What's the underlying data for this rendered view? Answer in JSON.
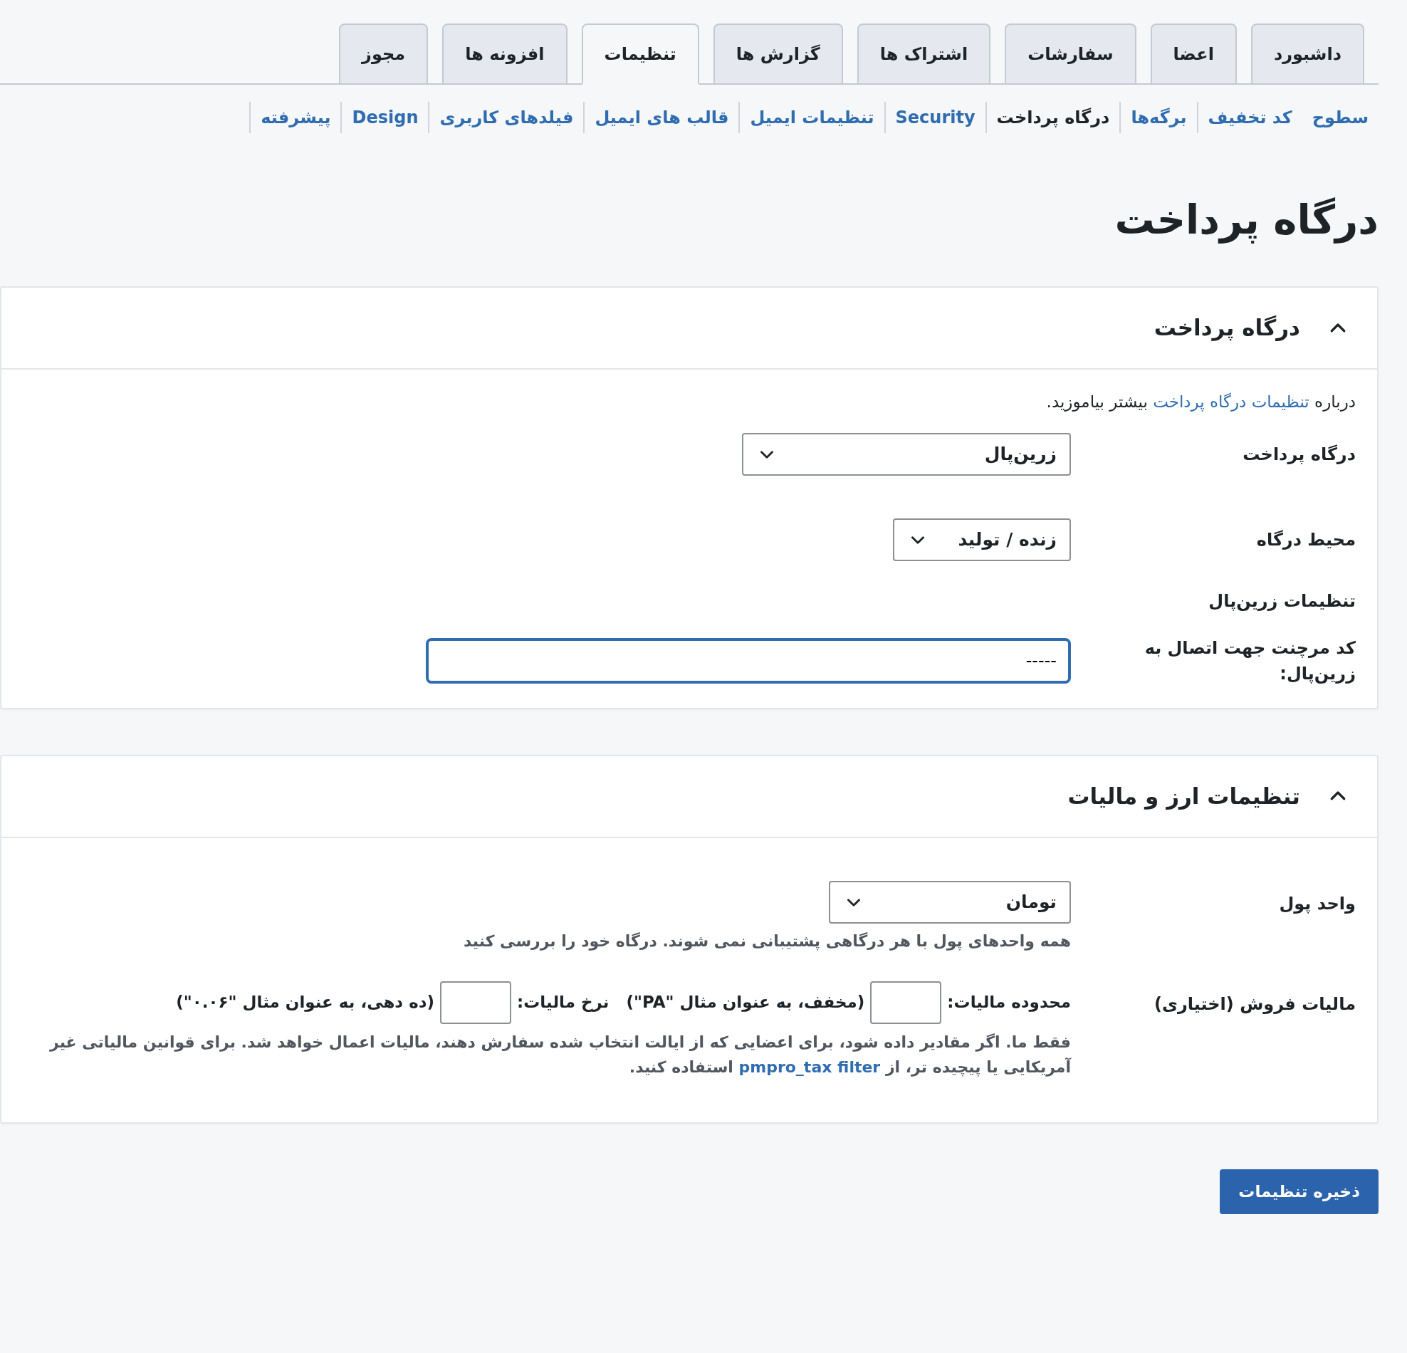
{
  "tabs": [
    {
      "label": "داشبورد",
      "selected": false
    },
    {
      "label": "اعضا",
      "selected": false
    },
    {
      "label": "سفارشات",
      "selected": false
    },
    {
      "label": "اشتراک ها",
      "selected": false
    },
    {
      "label": "گزارش ها",
      "selected": false
    },
    {
      "label": "تنظیمات",
      "selected": true
    },
    {
      "label": "افزونه ها",
      "selected": false
    },
    {
      "label": "مجوز",
      "selected": false
    }
  ],
  "subnav": [
    {
      "label": "سطوح",
      "selected": false
    },
    {
      "label": "کد تخفیف",
      "selected": false
    },
    {
      "label": "برگه‌ها",
      "selected": false
    },
    {
      "label": "درگاه پرداخت",
      "selected": true
    },
    {
      "label": "Security",
      "selected": false
    },
    {
      "label": "تنظیمات ایمیل",
      "selected": false
    },
    {
      "label": "قالب های ایمیل",
      "selected": false
    },
    {
      "label": "فیلدهای کاربری",
      "selected": false
    },
    {
      "label": "Design",
      "selected": false
    },
    {
      "label": "پیشرفته",
      "selected": false
    }
  ],
  "page_title": "درگاه پرداخت",
  "gateway_section": {
    "title": "درگاه پرداخت",
    "expanded": true,
    "intro": {
      "before": "درباره",
      "link": "تنظیمات درگاه پرداخت",
      "after": "بیشتر بیاموزید."
    },
    "gateway": {
      "label": "درگاه پرداخت",
      "value": "زرین‌پال"
    },
    "environment": {
      "label": "محیط درگاه",
      "value": "زنده / تولید"
    },
    "subheading": "تنظیمات زرین‌پال",
    "merchant": {
      "label": "کد مرچنت جهت اتصال به زرین‌پال:",
      "value": "-----",
      "focused": true
    }
  },
  "currency_section": {
    "title": "تنظیمات ارز و مالیات",
    "expanded": true,
    "currency": {
      "label": "واحد پول",
      "value": "تومان",
      "note": "همه واحدهای پول با هر درگاهی پشتیبانی نمی شوند. درگاه خود را بررسی کنید"
    },
    "tax": {
      "label": "مالیات فروش (اختیاری)",
      "state_label": "محدوده مالیات:",
      "state_hint": "(مخفف، به عنوان مثال \"PA\")",
      "rate_label": "نرخ مالیات:",
      "rate_hint": "(ده دهی، به عنوان مثال \"۰.۰۶\")",
      "help": {
        "before": "فقط ما. اگر مقادیر داده شود، برای اعضایی که از ایالت انتخاب شده سفارش دهند، مالیات اعمال خواهد شد. برای قوانین مالیاتی غیر آمریکایی یا پیچیده تر، از",
        "link": "pmpro_tax filter",
        "after": "استفاده کنید."
      }
    }
  },
  "save_button": "ذخیره تنظیمات"
}
